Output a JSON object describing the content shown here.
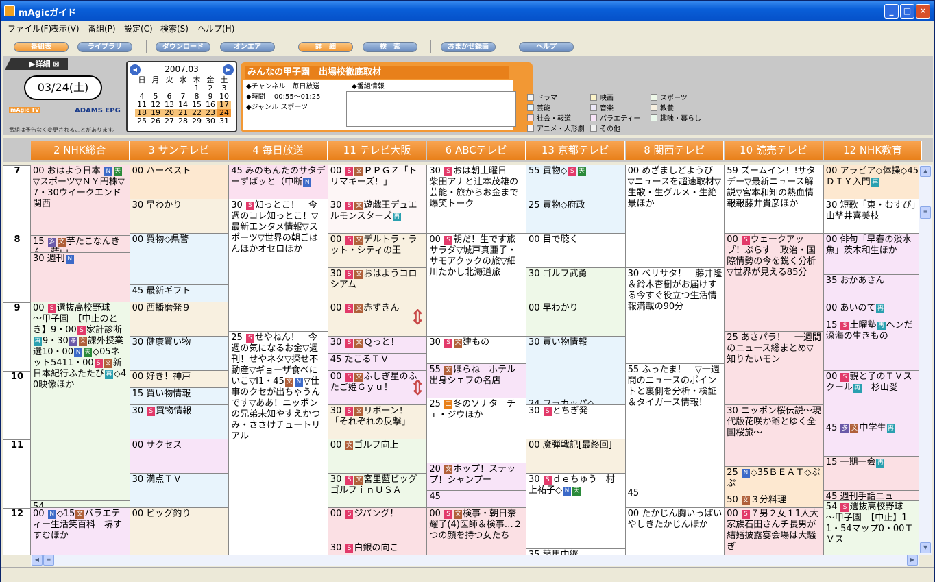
{
  "window": {
    "title": "mAgicガイド"
  },
  "menu": [
    "ファイル(F)",
    "表示(V)",
    "番組(P)",
    "設定(C)",
    "検索(S)",
    "ヘルプ(H)"
  ],
  "toolbar": [
    "番組表",
    "ライブラリ",
    "ダウンロード",
    "オンエア",
    "詳　細",
    "検　索",
    "おまかせ録画",
    "ヘルプ"
  ],
  "detail_tab": "▶詳細 ⊠",
  "date_display": "03/24(土)",
  "logo": {
    "magic": "mAgic TV",
    "adams": "ADAMS EPG",
    "note": "番組は予告なく変更されることがあります。"
  },
  "calendar": {
    "month": "2007.03",
    "weekdays": [
      "日",
      "月",
      "火",
      "水",
      "木",
      "金",
      "土"
    ],
    "rows": [
      [
        "",
        "",
        "",
        "",
        "1",
        "2",
        "3"
      ],
      [
        "4",
        "5",
        "6",
        "7",
        "8",
        "9",
        "10"
      ],
      [
        "11",
        "12",
        "13",
        "14",
        "15",
        "16",
        "17"
      ],
      [
        "18",
        "19",
        "20",
        "21",
        "22",
        "23",
        "24"
      ],
      [
        "25",
        "26",
        "27",
        "28",
        "29",
        "30",
        "31"
      ]
    ]
  },
  "program": {
    "title": "みんなの甲子園　出場校徹底取材",
    "channel": "◆チャンネル　毎日放送",
    "time": "◆時間　 00:55～01:25",
    "genre": "◆ジャンル スポーツ",
    "info_label": "◆番組情報"
  },
  "legend": [
    {
      "label": "ドラマ",
      "color": "#f4f4f4"
    },
    {
      "label": "映画",
      "color": "#fbf3c8"
    },
    {
      "label": "スポーツ",
      "color": "#eef8e8"
    },
    {
      "label": "芸能",
      "color": "#e8f4fc"
    },
    {
      "label": "音楽",
      "color": "#ece8f8"
    },
    {
      "label": "教養",
      "color": "#f8f0e0"
    },
    {
      "label": "社会・報道",
      "color": "#fbe0e4"
    },
    {
      "label": "バラエティー",
      "color": "#f8e4f8"
    },
    {
      "label": "趣味・暮らし",
      "color": "#eaf8ec"
    },
    {
      "label": "アニメ・人形劇",
      "color": "#fdf6f6"
    },
    {
      "label": "その他",
      "color": "#f0f0f0"
    }
  ],
  "channels": [
    "2 NHK総合",
    "3 サンテレビ",
    "4 毎日放送",
    "11 テレビ大阪",
    "6 ABCテレビ",
    "13 京都テレビ",
    "8 関西テレビ",
    "10 読売テレビ",
    "12 NHK教育"
  ],
  "hours": [
    "7",
    "8",
    "9",
    "10",
    "11",
    "12"
  ],
  "programs": [
    [
      {
        "s": 0,
        "e": 2.05,
        "c": "#fbe0e4",
        "t": "00 おはよう日本 [N][天]▽スポーツ▽ＮＹ円株▽7・30ウイークエンド関西"
      },
      {
        "s": 2.05,
        "e": 2.55,
        "c": "#fbe0e4",
        "t": "15 [多][文]芋たこなんきん　藤山"
      },
      {
        "s": 2.55,
        "e": 4,
        "c": "#fbe0e4",
        "t": "30 週刊[N]"
      },
      {
        "s": 4,
        "e": 9.8,
        "c": "#eef8e8",
        "t": "00 [S]選抜高校野球　～甲子園　【中止のとき】9・00[S]家計診断[再]9・30[多][文]課外授業選10・00[N][天]◇05ネット5411・00[S][文]新日本紀行ふたたび[再]◇40映像ほか"
      },
      {
        "s": 9.8,
        "e": 10,
        "c": "#eef8e8",
        "t": "54"
      },
      {
        "s": 10,
        "e": 11.4,
        "c": "#f8e4f8",
        "t": "00 [N]◇15[文]バラエティー生活笑百科　堺すすむほか"
      }
    ],
    [
      {
        "s": 0,
        "e": 1,
        "c": "#fde8d0",
        "t": "00 ハーベスト"
      },
      {
        "s": 1,
        "e": 2,
        "c": "#f8f0e0",
        "t": "30 早わかり"
      },
      {
        "s": 2,
        "e": 3.5,
        "c": "#e8f4fc",
        "t": "00 買物◇県警"
      },
      {
        "s": 3.5,
        "e": 4,
        "c": "#e8f4fc",
        "t": "45 最新ギフト"
      },
      {
        "s": 4,
        "e": 5,
        "c": "#f8f0e0",
        "t": "00 西播磨発９"
      },
      {
        "s": 5,
        "e": 6,
        "c": "#e8f4fc",
        "t": "30 健康買い物"
      },
      {
        "s": 6,
        "e": 6.5,
        "c": "#f8f0e0",
        "t": "00 好き！神戸"
      },
      {
        "s": 6.5,
        "e": 7,
        "c": "#e8f4fc",
        "t": "15 買い物情報"
      },
      {
        "s": 7,
        "e": 8,
        "c": "#e8f4fc",
        "t": "30 [S]買物情報"
      },
      {
        "s": 8,
        "e": 9,
        "c": "#f8e4f8",
        "t": "00 サクセス"
      },
      {
        "s": 9,
        "e": 10,
        "c": "#e8f4fc",
        "t": "30 満点ＴＶ"
      },
      {
        "s": 10,
        "e": 11.4,
        "c": "#f8f0e0",
        "t": "00 ビッグ釣り"
      }
    ],
    [
      {
        "s": 0,
        "e": 1,
        "c": "#fbe0f0",
        "t": "45 みのもんたのサタデーずばッと（中断[N]"
      },
      {
        "s": 1,
        "e": 4.85,
        "c": "#fff",
        "t": "30 [S]知っとこ！　今週のコレ知っとこ！▽最新エンタメ情報▽スポーツ▽世界の朝ごはんほかオセロほか"
      },
      {
        "s": 4.85,
        "e": 11.4,
        "c": "#fff",
        "t": "25 [S]せやねん！　今週の気になるお金▽週刊！せやネタ▽探せ不動産▽ギョーザ食べにいこ▽Ⅰ1・45[文][N]▽仕事のクセが出ちゃうんです▽ああ！ニッポンの兄弟未知やすえかつみ・ささけチュートリアル"
      }
    ],
    [
      {
        "s": 0,
        "e": 1,
        "c": "#fdf6f6",
        "t": "00 [S][文]ＰＰＧＺ「トリマキーズ！」"
      },
      {
        "s": 1,
        "e": 2,
        "c": "#fdf6f6",
        "t": "30 [S][文]遊戯王デュエルモンスターズ[再]"
      },
      {
        "s": 2,
        "e": 3,
        "c": "#f8f0e0",
        "t": "00 [S][文]デルトラ・ラット・シティの王"
      },
      {
        "s": 3,
        "e": 4,
        "c": "#f8f0e0",
        "t": "30 [S][文]おはようコロシアム"
      },
      {
        "s": 4,
        "e": 5,
        "c": "#f8f0e0",
        "t": "00 [S][文]赤ずきん"
      },
      {
        "s": 5,
        "e": 5.5,
        "c": "#f8e4f8",
        "t": "30 [S][文]Ｑっと！"
      },
      {
        "s": 5.5,
        "e": 6,
        "c": "#f8e4f8",
        "t": "45 たこるＴＶ"
      },
      {
        "s": 6,
        "e": 7,
        "c": "#f8e4f8",
        "t": "00 [S][文]ふしぎ星のふたご姫Ｇｙｕ！"
      },
      {
        "s": 7,
        "e": 8,
        "c": "#f8f0e0",
        "t": "30 [S][文]リボーン！「それぞれの反撃」"
      },
      {
        "s": 8,
        "e": 9,
        "c": "#eef8e8",
        "t": "00 [文]ゴルフ向上"
      },
      {
        "s": 9,
        "e": 10,
        "c": "#eef8e8",
        "t": "30 [S][文]宮里藍ビッグゴルフｉｎＵＳＡ"
      },
      {
        "s": 10,
        "e": 11,
        "c": "#fbe0e4",
        "t": "00 [S]ジパング！"
      },
      {
        "s": 11,
        "e": 11.4,
        "c": "#fbe0e4",
        "t": "30 [S]白銀の向こ"
      }
    ],
    [
      {
        "s": 0,
        "e": 2,
        "c": "#fff",
        "t": "30 [S]おは朝土曜日　柴田アナと辻本茂雄の芸能・旅からお金まで爆笑トーク"
      },
      {
        "s": 2,
        "e": 5,
        "c": "#fff",
        "t": "00 [S]朝だ！生です旅サラダ▽城戸真亜子・サモアクックの旅▽細川たかし北海道旅"
      },
      {
        "s": 5,
        "e": 5.8,
        "c": "#fff",
        "t": "30 [S][文]建もの"
      },
      {
        "s": 5.8,
        "e": 6.8,
        "c": "#f8e4f8",
        "t": "55 [文]ほらね　ホテル出身シェフの名店"
      },
      {
        "s": 6.8,
        "e": 8.7,
        "c": "#fff",
        "t": "25 [二]冬のソナタ　チェ・ジウほか"
      },
      {
        "s": 8.7,
        "e": 9.5,
        "c": "#f8e4f8",
        "t": "20 [文]ホップ！ステップ！シャンプー"
      },
      {
        "s": 9.5,
        "e": 10,
        "c": "#f8e4f8",
        "t": "45"
      },
      {
        "s": 10,
        "e": 11.4,
        "c": "#fbe0e4",
        "t": "00 [S][文]検事・朝日奈耀子(4)医師＆検事…２つの顔を持つ女たち"
      }
    ],
    [
      {
        "s": 0,
        "e": 1,
        "c": "#e8f4fc",
        "t": "55 買物◇[S][天]"
      },
      {
        "s": 1,
        "e": 2,
        "c": "#e8f4fc",
        "t": "25 買物◇府政"
      },
      {
        "s": 2,
        "e": 3,
        "c": "#fff",
        "t": "00 目で聴く"
      },
      {
        "s": 3,
        "e": 4,
        "c": "#eef8e8",
        "t": "30 ゴルフ武勇"
      },
      {
        "s": 4,
        "e": 5,
        "c": "#eef8e8",
        "t": "00 早わかり"
      },
      {
        "s": 5,
        "e": 6.8,
        "c": "#e8f4fc",
        "t": "30 買い物情報"
      },
      {
        "s": 6.8,
        "e": 7,
        "c": "#e8f4fc",
        "t": "24 フラカッパ◇"
      },
      {
        "s": 7,
        "e": 8,
        "c": "#fff",
        "t": "30 [S]とちぎ発"
      },
      {
        "s": 8,
        "e": 9,
        "c": "#f8f0e0",
        "t": "00 魔弾戦記[最終回]"
      },
      {
        "s": 9,
        "e": 11.2,
        "c": "#fff",
        "t": "30 [S]ｄｅちゅう　村上祐子◇[N][天]"
      },
      {
        "s": 11.2,
        "e": 11.4,
        "c": "#fff",
        "t": "35 競馬中継"
      }
    ],
    [
      {
        "s": 0,
        "e": 3,
        "c": "#fff",
        "t": "00 めざましどようび　▽ニュースを超速取材▽生歌・生グルメ・生絶景ほか"
      },
      {
        "s": 3,
        "e": 5.8,
        "c": "#fff",
        "t": "30 ベリサタ！　藤井隆＆鈴木杏樹がお届けする今すぐ役立つ生活情報満載の90分"
      },
      {
        "s": 5.8,
        "e": 9.4,
        "c": "#fff",
        "t": "55 ふったま！　▽一週間のニュースのポイントと裏側を分析・検証＆タイガース情報！"
      },
      {
        "s": 9.4,
        "e": 10,
        "c": "#fff",
        "t": "45"
      },
      {
        "s": 10,
        "e": 11.4,
        "c": "#fff",
        "t": "00 たかじん胸いっぱい　やしきたかじんほか"
      }
    ],
    [
      {
        "s": 0,
        "e": 2,
        "c": "#fff",
        "t": "59 ズームイン！!サタデー▽最新ニュース解説▽宮本和知の熱血情報報藤井貴彦ほか"
      },
      {
        "s": 2,
        "e": 4.85,
        "c": "#fbe0e4",
        "t": "00 [S]ウェークアップ！ぷらす　政治・国際情勢の今を鋭く分析▽世界が見える85分"
      },
      {
        "s": 4.85,
        "e": 7,
        "c": "#fbe0e4",
        "t": "25 あさパラ！　一週間のニュース総まとめ▽知りたいモン"
      },
      {
        "s": 7,
        "e": 8.8,
        "c": "#fbe0e4",
        "t": "30 ニッポン桜伝説～現代版花咲か爺とゆく全国桜旅～"
      },
      {
        "s": 8.8,
        "e": 9.6,
        "c": "#fde8d0",
        "t": "25 [N]◇35ＢＥＡＴ◇ぷぷ"
      },
      {
        "s": 9.6,
        "e": 10,
        "c": "#fde8d0",
        "t": "50 [文]３分料理"
      },
      {
        "s": 10,
        "e": 11.4,
        "c": "#fbe0e4",
        "t": "00 [S]７男２女１1人大家族石田さんチ長男が結婚披露宴会場は大騒ぎ"
      }
    ],
    [
      {
        "s": 0,
        "e": 1,
        "c": "#fde8d0",
        "t": "00 アラビア◇体操◇45ＤＩＹ入門[再]"
      },
      {
        "s": 1,
        "e": 2,
        "c": "#fff",
        "t": "30 短歌「東・むすび」山埜井喜美枝"
      },
      {
        "s": 2,
        "e": 3.2,
        "c": "#f8e4f8",
        "t": "00 俳句「早春の淡水魚」茨木和生ほか"
      },
      {
        "s": 3.2,
        "e": 4,
        "c": "#f8e4f8",
        "t": "35 おかあさん"
      },
      {
        "s": 4,
        "e": 4.5,
        "c": "#f8e4f8",
        "t": "00 あいのて[再]"
      },
      {
        "s": 4.5,
        "e": 6,
        "c": "#f8e4f8",
        "t": "15 [S]土曜塾[再]ヘンだ深海の生きもの"
      },
      {
        "s": 6,
        "e": 7.5,
        "c": "#f8e4f8",
        "t": "00 [S]親と子のＴＶスクール[再]　杉山愛"
      },
      {
        "s": 7.5,
        "e": 8.5,
        "c": "#f8e4f8",
        "t": "45 [多][文]中学生[再]"
      },
      {
        "s": 8.5,
        "e": 9.5,
        "c": "#fbe0e4",
        "t": "15 一期一会[再]"
      },
      {
        "s": 9.5,
        "e": 9.8,
        "c": "#fbe0e4",
        "t": "45 週刊手話ニュ"
      },
      {
        "s": 9.8,
        "e": 11.4,
        "c": "#eef8e8",
        "t": "54 [S]選抜高校野球　～甲子園　【中止】1 1・54マップ0・00ＴＶス"
      }
    ]
  ]
}
